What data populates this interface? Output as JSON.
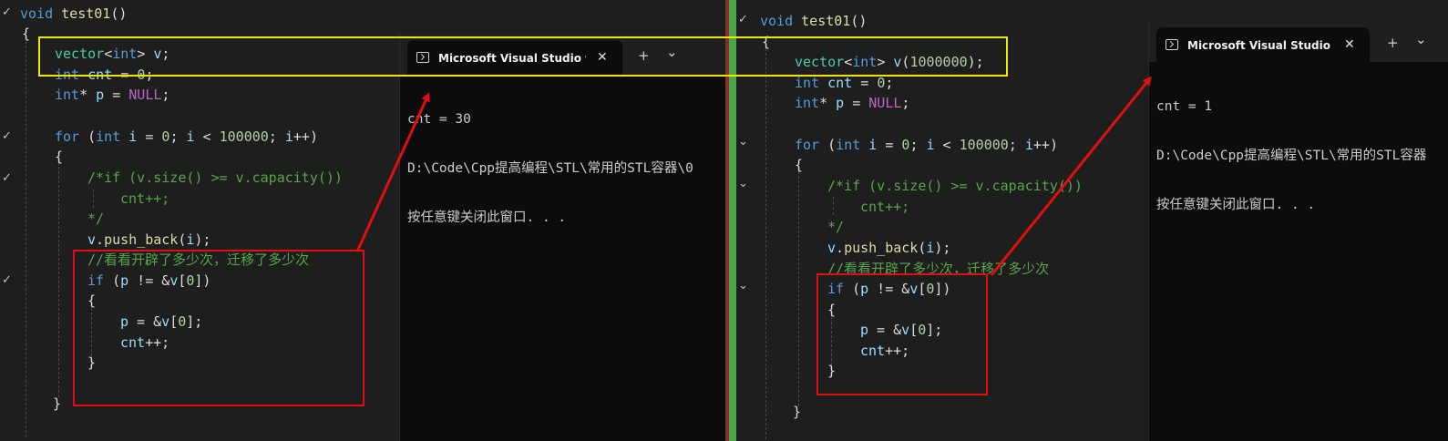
{
  "left_editor": {
    "lines": [
      [
        {
          "t": "void ",
          "c": "kw"
        },
        {
          "t": "test01",
          "c": "fn"
        },
        {
          "t": "()",
          "c": "pl"
        }
      ],
      [
        {
          "t": "{",
          "c": "pl"
        }
      ],
      [
        {
          "t": "vector",
          "c": "ty"
        },
        {
          "t": "<",
          "c": "pl"
        },
        {
          "t": "int",
          "c": "kw"
        },
        {
          "t": "> ",
          "c": "pl"
        },
        {
          "t": "v",
          "c": "var"
        },
        {
          "t": ";",
          "c": "pl"
        }
      ],
      [
        {
          "t": "int ",
          "c": "kw"
        },
        {
          "t": "cnt",
          "c": "var"
        },
        {
          "t": " = ",
          "c": "pl"
        },
        {
          "t": "0",
          "c": "num"
        },
        {
          "t": ";",
          "c": "pl"
        }
      ],
      [
        {
          "t": "int",
          "c": "kw"
        },
        {
          "t": "* ",
          "c": "pl"
        },
        {
          "t": "p",
          "c": "var"
        },
        {
          "t": " = ",
          "c": "pl"
        },
        {
          "t": "NULL",
          "c": "mac"
        },
        {
          "t": ";",
          "c": "pl"
        }
      ],
      [],
      [
        {
          "t": "for ",
          "c": "kw"
        },
        {
          "t": "(",
          "c": "pl"
        },
        {
          "t": "int ",
          "c": "kw"
        },
        {
          "t": "i",
          "c": "var"
        },
        {
          "t": " = ",
          "c": "pl"
        },
        {
          "t": "0",
          "c": "num"
        },
        {
          "t": "; ",
          "c": "pl"
        },
        {
          "t": "i",
          "c": "var"
        },
        {
          "t": " < ",
          "c": "pl"
        },
        {
          "t": "100000",
          "c": "num"
        },
        {
          "t": "; ",
          "c": "pl"
        },
        {
          "t": "i",
          "c": "var"
        },
        {
          "t": "++)",
          "c": "pl"
        }
      ],
      [
        {
          "t": "{",
          "c": "pl"
        }
      ],
      [
        {
          "t": "/*if (v.size() >= v.capacity())",
          "c": "cmt"
        }
      ],
      [
        {
          "t": "cnt++;",
          "c": "cmt"
        }
      ],
      [
        {
          "t": "*/",
          "c": "cmt"
        }
      ],
      [
        {
          "t": "v",
          "c": "var"
        },
        {
          "t": ".",
          "c": "pl"
        },
        {
          "t": "push_back",
          "c": "fn"
        },
        {
          "t": "(",
          "c": "pl"
        },
        {
          "t": "i",
          "c": "var"
        },
        {
          "t": ");",
          "c": "pl"
        }
      ],
      [
        {
          "t": "//看看开辟了多少次，迁移了多少次",
          "c": "cmt"
        }
      ],
      [
        {
          "t": "if ",
          "c": "kw"
        },
        {
          "t": "(",
          "c": "pl"
        },
        {
          "t": "p",
          "c": "var"
        },
        {
          "t": " != &",
          "c": "pl"
        },
        {
          "t": "v",
          "c": "var"
        },
        {
          "t": "[",
          "c": "pl"
        },
        {
          "t": "0",
          "c": "num"
        },
        {
          "t": "])",
          "c": "pl"
        }
      ],
      [
        {
          "t": "{",
          "c": "pl"
        }
      ],
      [
        {
          "t": "p",
          "c": "var"
        },
        {
          "t": " = &",
          "c": "pl"
        },
        {
          "t": "v",
          "c": "var"
        },
        {
          "t": "[",
          "c": "pl"
        },
        {
          "t": "0",
          "c": "num"
        },
        {
          "t": "];",
          "c": "pl"
        }
      ],
      [
        {
          "t": "cnt",
          "c": "var"
        },
        {
          "t": "++;",
          "c": "pl"
        }
      ],
      [
        {
          "t": "}",
          "c": "pl"
        }
      ],
      [],
      [
        {
          "t": "}",
          "c": "pl"
        }
      ]
    ]
  },
  "right_editor": {
    "lines": [
      [
        {
          "t": "void ",
          "c": "kw"
        },
        {
          "t": "test01",
          "c": "fn"
        },
        {
          "t": "()",
          "c": "pl"
        }
      ],
      [
        {
          "t": "{",
          "c": "pl"
        }
      ],
      [
        {
          "t": "vector",
          "c": "ty"
        },
        {
          "t": "<",
          "c": "pl"
        },
        {
          "t": "int",
          "c": "kw"
        },
        {
          "t": "> ",
          "c": "pl"
        },
        {
          "t": "v",
          "c": "var"
        },
        {
          "t": "(",
          "c": "pl"
        },
        {
          "t": "1000000",
          "c": "num"
        },
        {
          "t": ");",
          "c": "pl"
        }
      ],
      [
        {
          "t": "int ",
          "c": "kw"
        },
        {
          "t": "cnt",
          "c": "var"
        },
        {
          "t": " = ",
          "c": "pl"
        },
        {
          "t": "0",
          "c": "num"
        },
        {
          "t": ";",
          "c": "pl"
        }
      ],
      [
        {
          "t": "int",
          "c": "kw"
        },
        {
          "t": "* ",
          "c": "pl"
        },
        {
          "t": "p",
          "c": "var"
        },
        {
          "t": " = ",
          "c": "pl"
        },
        {
          "t": "NULL",
          "c": "mac"
        },
        {
          "t": ";",
          "c": "pl"
        }
      ],
      [],
      [
        {
          "t": "for ",
          "c": "kw"
        },
        {
          "t": "(",
          "c": "pl"
        },
        {
          "t": "int ",
          "c": "kw"
        },
        {
          "t": "i",
          "c": "var"
        },
        {
          "t": " = ",
          "c": "pl"
        },
        {
          "t": "0",
          "c": "num"
        },
        {
          "t": "; ",
          "c": "pl"
        },
        {
          "t": "i",
          "c": "var"
        },
        {
          "t": " < ",
          "c": "pl"
        },
        {
          "t": "100000",
          "c": "num"
        },
        {
          "t": "; ",
          "c": "pl"
        },
        {
          "t": "i",
          "c": "var"
        },
        {
          "t": "++)",
          "c": "pl"
        }
      ],
      [
        {
          "t": "{",
          "c": "pl"
        }
      ],
      [
        {
          "t": "/*if (v.size() >= v.capacity())",
          "c": "cmt"
        }
      ],
      [
        {
          "t": "cnt++;",
          "c": "cmt"
        }
      ],
      [
        {
          "t": "*/",
          "c": "cmt"
        }
      ],
      [
        {
          "t": "v",
          "c": "var"
        },
        {
          "t": ".",
          "c": "pl"
        },
        {
          "t": "push_back",
          "c": "fn"
        },
        {
          "t": "(",
          "c": "pl"
        },
        {
          "t": "i",
          "c": "var"
        },
        {
          "t": ");",
          "c": "pl"
        }
      ],
      [
        {
          "t": "//看看开辟了多少次，迁移了多少次",
          "c": "cmt"
        }
      ],
      [
        {
          "t": "if ",
          "c": "kw"
        },
        {
          "t": "(",
          "c": "pl"
        },
        {
          "t": "p",
          "c": "var"
        },
        {
          "t": " != &",
          "c": "pl"
        },
        {
          "t": "v",
          "c": "var"
        },
        {
          "t": "[",
          "c": "pl"
        },
        {
          "t": "0",
          "c": "num"
        },
        {
          "t": "])",
          "c": "pl"
        }
      ],
      [
        {
          "t": "{",
          "c": "pl"
        }
      ],
      [
        {
          "t": "p",
          "c": "var"
        },
        {
          "t": " = &",
          "c": "pl"
        },
        {
          "t": "v",
          "c": "var"
        },
        {
          "t": "[",
          "c": "pl"
        },
        {
          "t": "0",
          "c": "num"
        },
        {
          "t": "];",
          "c": "pl"
        }
      ],
      [
        {
          "t": "cnt",
          "c": "var"
        },
        {
          "t": "++;",
          "c": "pl"
        }
      ],
      [
        {
          "t": "}",
          "c": "pl"
        }
      ],
      [],
      [
        {
          "t": "}",
          "c": "pl"
        }
      ]
    ]
  },
  "left_terminal": {
    "tab_title": "Microsoft Visual Studio 调试控制台",
    "close_glyph": "✕",
    "add_glyph": "+",
    "dropdown_glyph": "⌄",
    "output": [
      "cnt = 30",
      "D:\\Code\\Cpp提高编程\\STL\\常用的STL容器\\0",
      "按任意键关闭此窗口. . ."
    ]
  },
  "right_terminal": {
    "tab_title": "Microsoft Visual Studio 调试控制台",
    "close_glyph": "✕",
    "add_glyph": "+",
    "dropdown_glyph": "⌄",
    "output": [
      "cnt = 1",
      "D:\\Code\\Cpp提高编程\\STL\\常用的STL容器",
      "按任意键关闭此窗口. . ."
    ]
  },
  "gutter": {
    "collapse_glyph": "⌄",
    "check_glyph": "✓"
  },
  "colors": {
    "yellow_box": "#f2e600",
    "red_box": "#e01010",
    "green_divider": "#4aa64a"
  }
}
